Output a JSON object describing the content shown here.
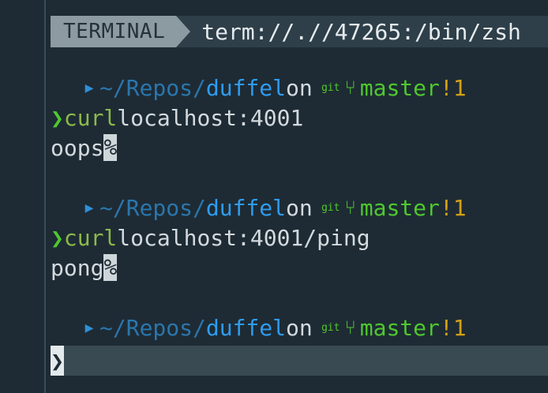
{
  "statusline": {
    "mode": "TERMINAL",
    "path": "term://.//47265:/bin/zsh"
  },
  "prompt": {
    "apple_icon": "apple-icon",
    "folder_icon": "folder-icon",
    "path_prefix": "~/Repos/",
    "path_dir": "duffel",
    "on": "on",
    "git_label": "git",
    "branch_icon": "git-branch-icon",
    "branch": "master",
    "git_status": "!1",
    "prompt_char": "❯"
  },
  "session": [
    {
      "command": "curl",
      "args": "localhost:4001",
      "output": "oops",
      "eol_marker": "%"
    },
    {
      "command": "curl",
      "args": "localhost:4001/ping",
      "output": "pong",
      "eol_marker": "%"
    }
  ],
  "cursor": {
    "char": "❯"
  },
  "colors": {
    "background": "#1e2b34",
    "path": "#2f9cf0",
    "branch": "#4fc82f",
    "git_status": "#d4a012",
    "command": "#8db94a"
  }
}
